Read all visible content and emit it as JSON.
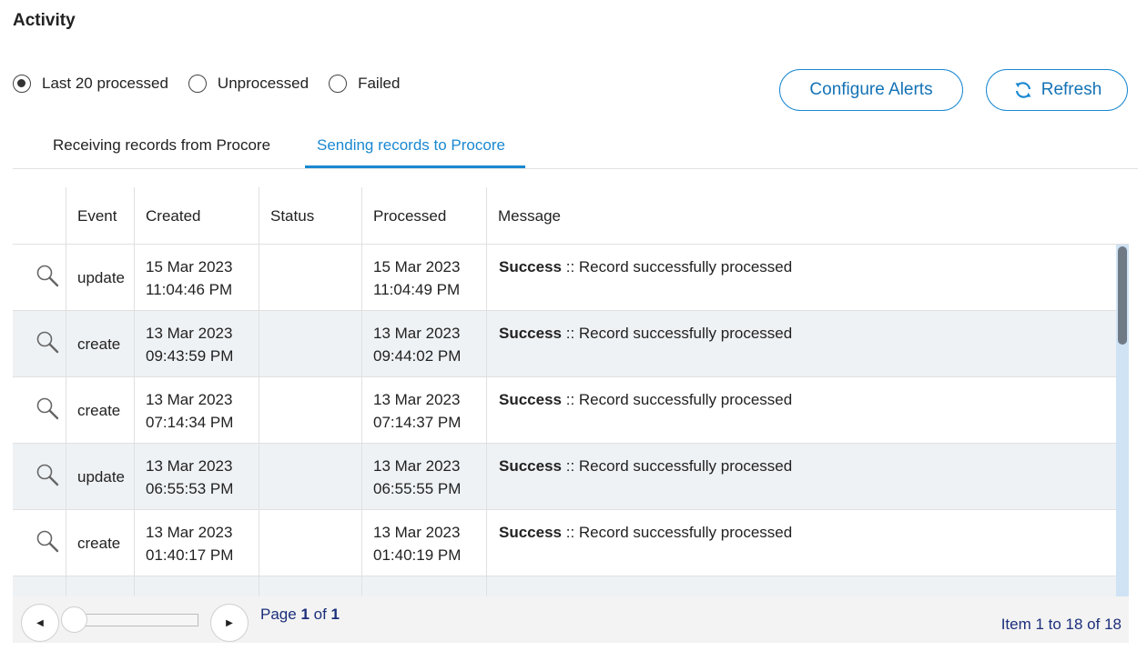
{
  "title": "Activity",
  "filters": [
    {
      "label": "Last 20 processed",
      "checked": true
    },
    {
      "label": "Unprocessed",
      "checked": false
    },
    {
      "label": "Failed",
      "checked": false
    }
  ],
  "buttons": {
    "configure_alerts": "Configure Alerts",
    "refresh": "Refresh"
  },
  "tabs": [
    {
      "label": "Receiving records from Procore",
      "active": false
    },
    {
      "label": "Sending records to Procore",
      "active": true
    }
  ],
  "grid": {
    "columns": [
      "Event",
      "Created",
      "Status",
      "Processed",
      "Message"
    ],
    "rows": [
      {
        "event": "update",
        "created_date": "15 Mar 2023",
        "created_time": "11:04:46 PM",
        "status": "",
        "processed_date": "15 Mar 2023",
        "processed_time": "11:04:49 PM",
        "msg_status": "Success",
        "msg_text": " :: Record successfully processed"
      },
      {
        "event": "create",
        "created_date": "13 Mar 2023",
        "created_time": "09:43:59 PM",
        "status": "",
        "processed_date": "13 Mar 2023",
        "processed_time": "09:44:02 PM",
        "msg_status": "Success",
        "msg_text": " :: Record successfully processed"
      },
      {
        "event": "create",
        "created_date": "13 Mar 2023",
        "created_time": "07:14:34 PM",
        "status": "",
        "processed_date": "13 Mar 2023",
        "processed_time": "07:14:37 PM",
        "msg_status": "Success",
        "msg_text": " :: Record successfully processed"
      },
      {
        "event": "update",
        "created_date": "13 Mar 2023",
        "created_time": "06:55:53 PM",
        "status": "",
        "processed_date": "13 Mar 2023",
        "processed_time": "06:55:55 PM",
        "msg_status": "Success",
        "msg_text": " :: Record successfully processed"
      },
      {
        "event": "create",
        "created_date": "13 Mar 2023",
        "created_time": "01:40:17 PM",
        "status": "",
        "processed_date": "13 Mar 2023",
        "processed_time": "01:40:19 PM",
        "msg_status": "Success",
        "msg_text": " :: Record successfully processed"
      }
    ]
  },
  "pager": {
    "page_prefix": "Page ",
    "page_current": "1",
    "page_of": " of ",
    "page_total": "1",
    "item_info": "Item 1 to 18 of 18"
  },
  "icons": {
    "row_view": "magnifier-icon",
    "refresh": "refresh-icon",
    "prev": "caret-left-icon",
    "next": "caret-right-icon"
  },
  "colors": {
    "accent": "#1a88d0",
    "row_alt": "#eff2f5",
    "pager_text": "#1c2f7a"
  }
}
